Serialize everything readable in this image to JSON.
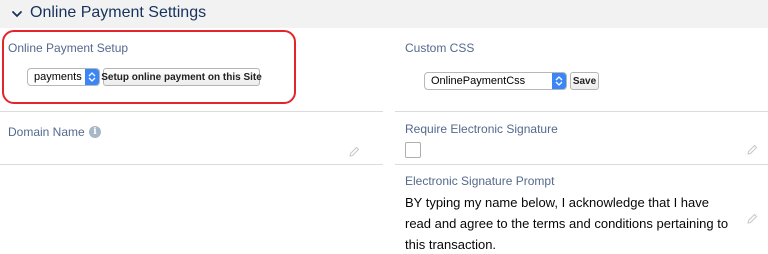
{
  "section": {
    "title": "Online Payment Settings"
  },
  "online_payment_setup": {
    "label": "Online Payment Setup",
    "select_value": "payments",
    "button_label": "Setup online payment on this Site"
  },
  "custom_css": {
    "label": "Custom CSS",
    "select_value": "OnlinePaymentCss",
    "save_label": "Save"
  },
  "domain_name": {
    "label": "Domain Name",
    "info_glyph": "i"
  },
  "require_signature": {
    "label": "Require Electronic Signature",
    "checked": false
  },
  "signature_prompt": {
    "label": "Electronic Signature Prompt",
    "text": "BY typing my name below, I acknowledge that I have read and agree to the terms and conditions pertaining to this transaction."
  },
  "icons": [
    "chevron-down-icon",
    "select-arrows-icon",
    "info-icon",
    "pencil-icon"
  ],
  "colors": {
    "accent": "#3b86f7",
    "highlight": "#e3242b",
    "label": "#54698d",
    "header_bg": "#f3f2f2"
  }
}
